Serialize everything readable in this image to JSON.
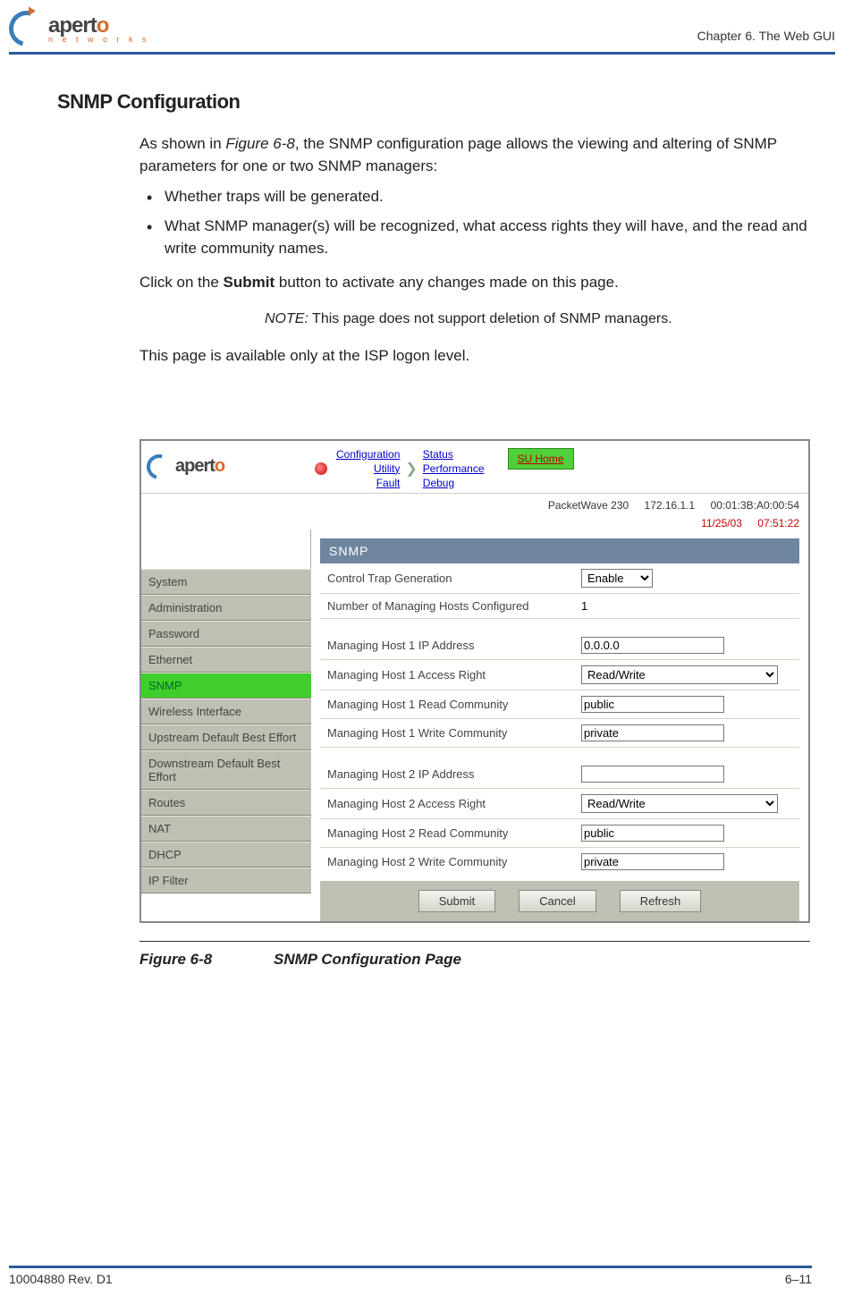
{
  "header": {
    "logo_text_pre": "apert",
    "logo_text_o": "o",
    "logo_sub": "n e t w o r k s",
    "chapter": "Chapter 6.  The Web GUI"
  },
  "section_title": "SNMP Configuration",
  "intro_pre": "As shown in ",
  "intro_ref": "Figure 6-8",
  "intro_post": ", the SNMP configuration page allows the viewing and altering of SNMP parameters for one or two SNMP managers:",
  "bullets": [
    "Whether traps will be generated.",
    "What SNMP manager(s) will be recognized, what access rights they will have, and the read and write community names."
  ],
  "submit_pre": "Click on the ",
  "submit_bold": "Submit",
  "submit_post": " button to activate any changes made on this page.",
  "note_label": "NOTE:",
  "note_text": "  This page does not support deletion of SNMP managers.",
  "isp_line": "This page is available only at the ISP logon level.",
  "shot": {
    "nav_left": [
      "Configuration",
      "Utility",
      "Fault"
    ],
    "nav_right": [
      "Status",
      "Performance",
      "Debug"
    ],
    "su_home": "SU Home",
    "device": "PacketWave 230",
    "ip": "172.16.1.1",
    "mac": "00:01:3B:A0:00:54",
    "date": "11/25/03",
    "time": "07:51:22",
    "side_items": [
      "System",
      "Administration",
      "Password",
      "Ethernet",
      "SNMP",
      "Wireless Interface",
      "Upstream Default Best Effort",
      "Downstream Default Best Effort",
      "Routes",
      "NAT",
      "DHCP",
      "IP Filter"
    ],
    "side_active_index": 4,
    "panel_title": "SNMP",
    "rows": {
      "trap_label": "Control Trap Generation",
      "trap_value": "Enable",
      "numhosts_label": "Number of Managing Hosts Configured",
      "numhosts_value": "1",
      "h1_ip_label": "Managing Host 1 IP Address",
      "h1_ip_value": "0.0.0.0",
      "h1_access_label": "Managing Host 1 Access Right",
      "h1_access_value": "Read/Write",
      "h1_rc_label": "Managing Host 1 Read Community",
      "h1_rc_value": "public",
      "h1_wc_label": "Managing Host 1 Write Community",
      "h1_wc_value": "private",
      "h2_ip_label": "Managing Host 2 IP Address",
      "h2_ip_value": "",
      "h2_access_label": "Managing Host 2 Access Right",
      "h2_access_value": "Read/Write",
      "h2_rc_label": "Managing Host 2 Read Community",
      "h2_rc_value": "public",
      "h2_wc_label": "Managing Host 2 Write Community",
      "h2_wc_value": "private"
    },
    "buttons": {
      "submit": "Submit",
      "cancel": "Cancel",
      "refresh": "Refresh"
    }
  },
  "figure": {
    "num": "Figure 6-8",
    "title": "SNMP Configuration Page"
  },
  "footer": {
    "rev": "10004880 Rev. D1",
    "page": "6–11"
  }
}
